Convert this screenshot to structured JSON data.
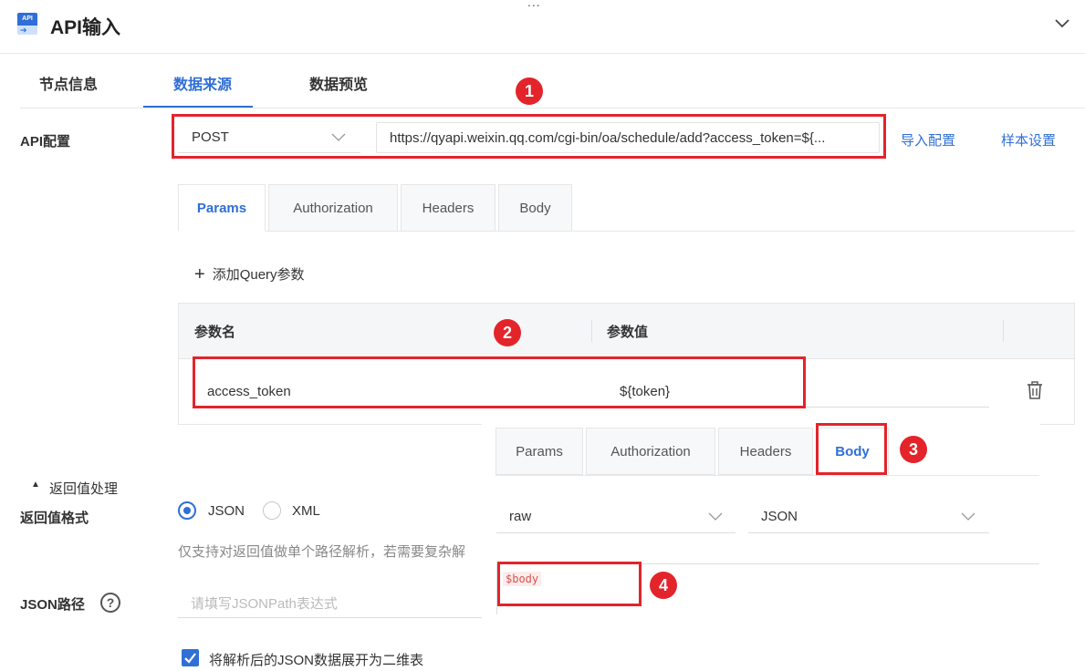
{
  "header": {
    "icon_text": "API",
    "title": "API输入",
    "dots": "..."
  },
  "main_tabs": [
    {
      "label": "节点信息",
      "active": false
    },
    {
      "label": "数据来源",
      "active": true
    },
    {
      "label": "数据预览",
      "active": false
    }
  ],
  "api_config": {
    "label": "API配置",
    "method": "POST",
    "url": "https://qyapi.weixin.qq.com/cgi-bin/oa/schedule/add?access_token=${...",
    "import_link": "导入配置",
    "sample_link": "样本设置"
  },
  "sub_tabs": [
    {
      "label": "Params",
      "active": true
    },
    {
      "label": "Authorization",
      "active": false
    },
    {
      "label": "Headers",
      "active": false
    },
    {
      "label": "Body",
      "active": false
    }
  ],
  "add_query_label": "添加Query参数",
  "params_table": {
    "headers": [
      "参数名",
      "参数值"
    ],
    "rows": [
      {
        "name": "access_token",
        "value": "${token}"
      }
    ]
  },
  "return_section": {
    "toggle_label": "返回值处理",
    "format_label": "返回值格式",
    "options": [
      {
        "label": "JSON",
        "selected": true
      },
      {
        "label": "XML",
        "selected": false
      }
    ],
    "hint": "仅支持对返回值做单个路径解析，若需要复杂解",
    "jsonpath_label": "JSON路径",
    "jsonpath_placeholder": "请填写JSONPath表达式",
    "flatten_label": "将解析后的JSON数据展开为二维表",
    "flatten_checked": true
  },
  "body_panel": {
    "tabs": [
      {
        "label": "Params",
        "active": false
      },
      {
        "label": "Authorization",
        "active": false
      },
      {
        "label": "Headers",
        "active": false
      },
      {
        "label": "Body",
        "active": true
      }
    ],
    "body_type": "raw",
    "content_type": "JSON",
    "content": "$body"
  },
  "badges": [
    "1",
    "2",
    "3",
    "4"
  ],
  "colors": {
    "accent": "#2f6fd6",
    "highlight": "#e3242b"
  }
}
